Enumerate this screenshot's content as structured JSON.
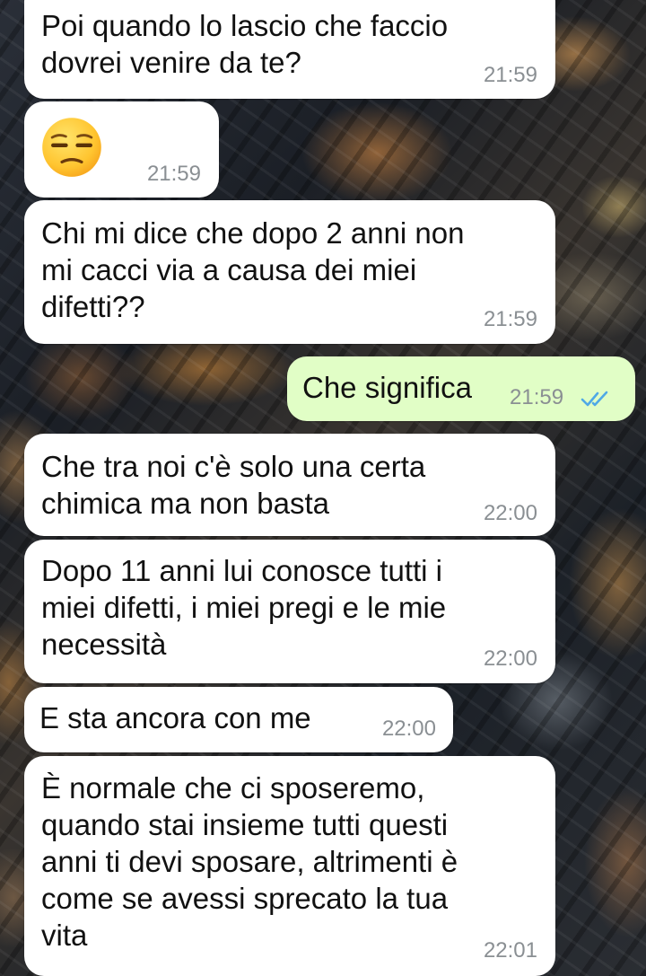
{
  "messages": [
    {
      "direction": "incoming",
      "text": "Poi quando lo lascio che faccio\ndovrei venire da te?",
      "time": "21:59"
    },
    {
      "direction": "incoming",
      "emoji": "unamused-face-icon",
      "time": "21:59"
    },
    {
      "direction": "incoming",
      "text": "Chi mi dice che dopo 2 anni non\nmi cacci via a causa dei miei\ndifetti??",
      "time": "21:59"
    },
    {
      "direction": "outgoing",
      "text": "Che significa",
      "time": "21:59",
      "status": "read",
      "status_icon": "double-check-icon"
    },
    {
      "direction": "incoming",
      "text": "Che tra noi c'è solo una certa\nchimica ma non basta",
      "time": "22:00"
    },
    {
      "direction": "incoming",
      "text": "Dopo 11 anni lui conosce tutti i\nmiei difetti, i miei pregi e le mie\nnecessità",
      "time": "22:00"
    },
    {
      "direction": "incoming",
      "text": "E sta ancora con me",
      "time": "22:00"
    },
    {
      "direction": "incoming",
      "text": "È normale che ci sposeremo,\nquando stai insieme tutti questi\nanni ti devi sposare, altrimenti è\ncome se avessi sprecato la tua\nvita",
      "time": "22:01"
    }
  ],
  "colors": {
    "incoming_bubble": "#ffffff",
    "outgoing_bubble": "#e1fec6",
    "timestamp": "#8a8f93",
    "read_check": "#4fa9e6"
  }
}
